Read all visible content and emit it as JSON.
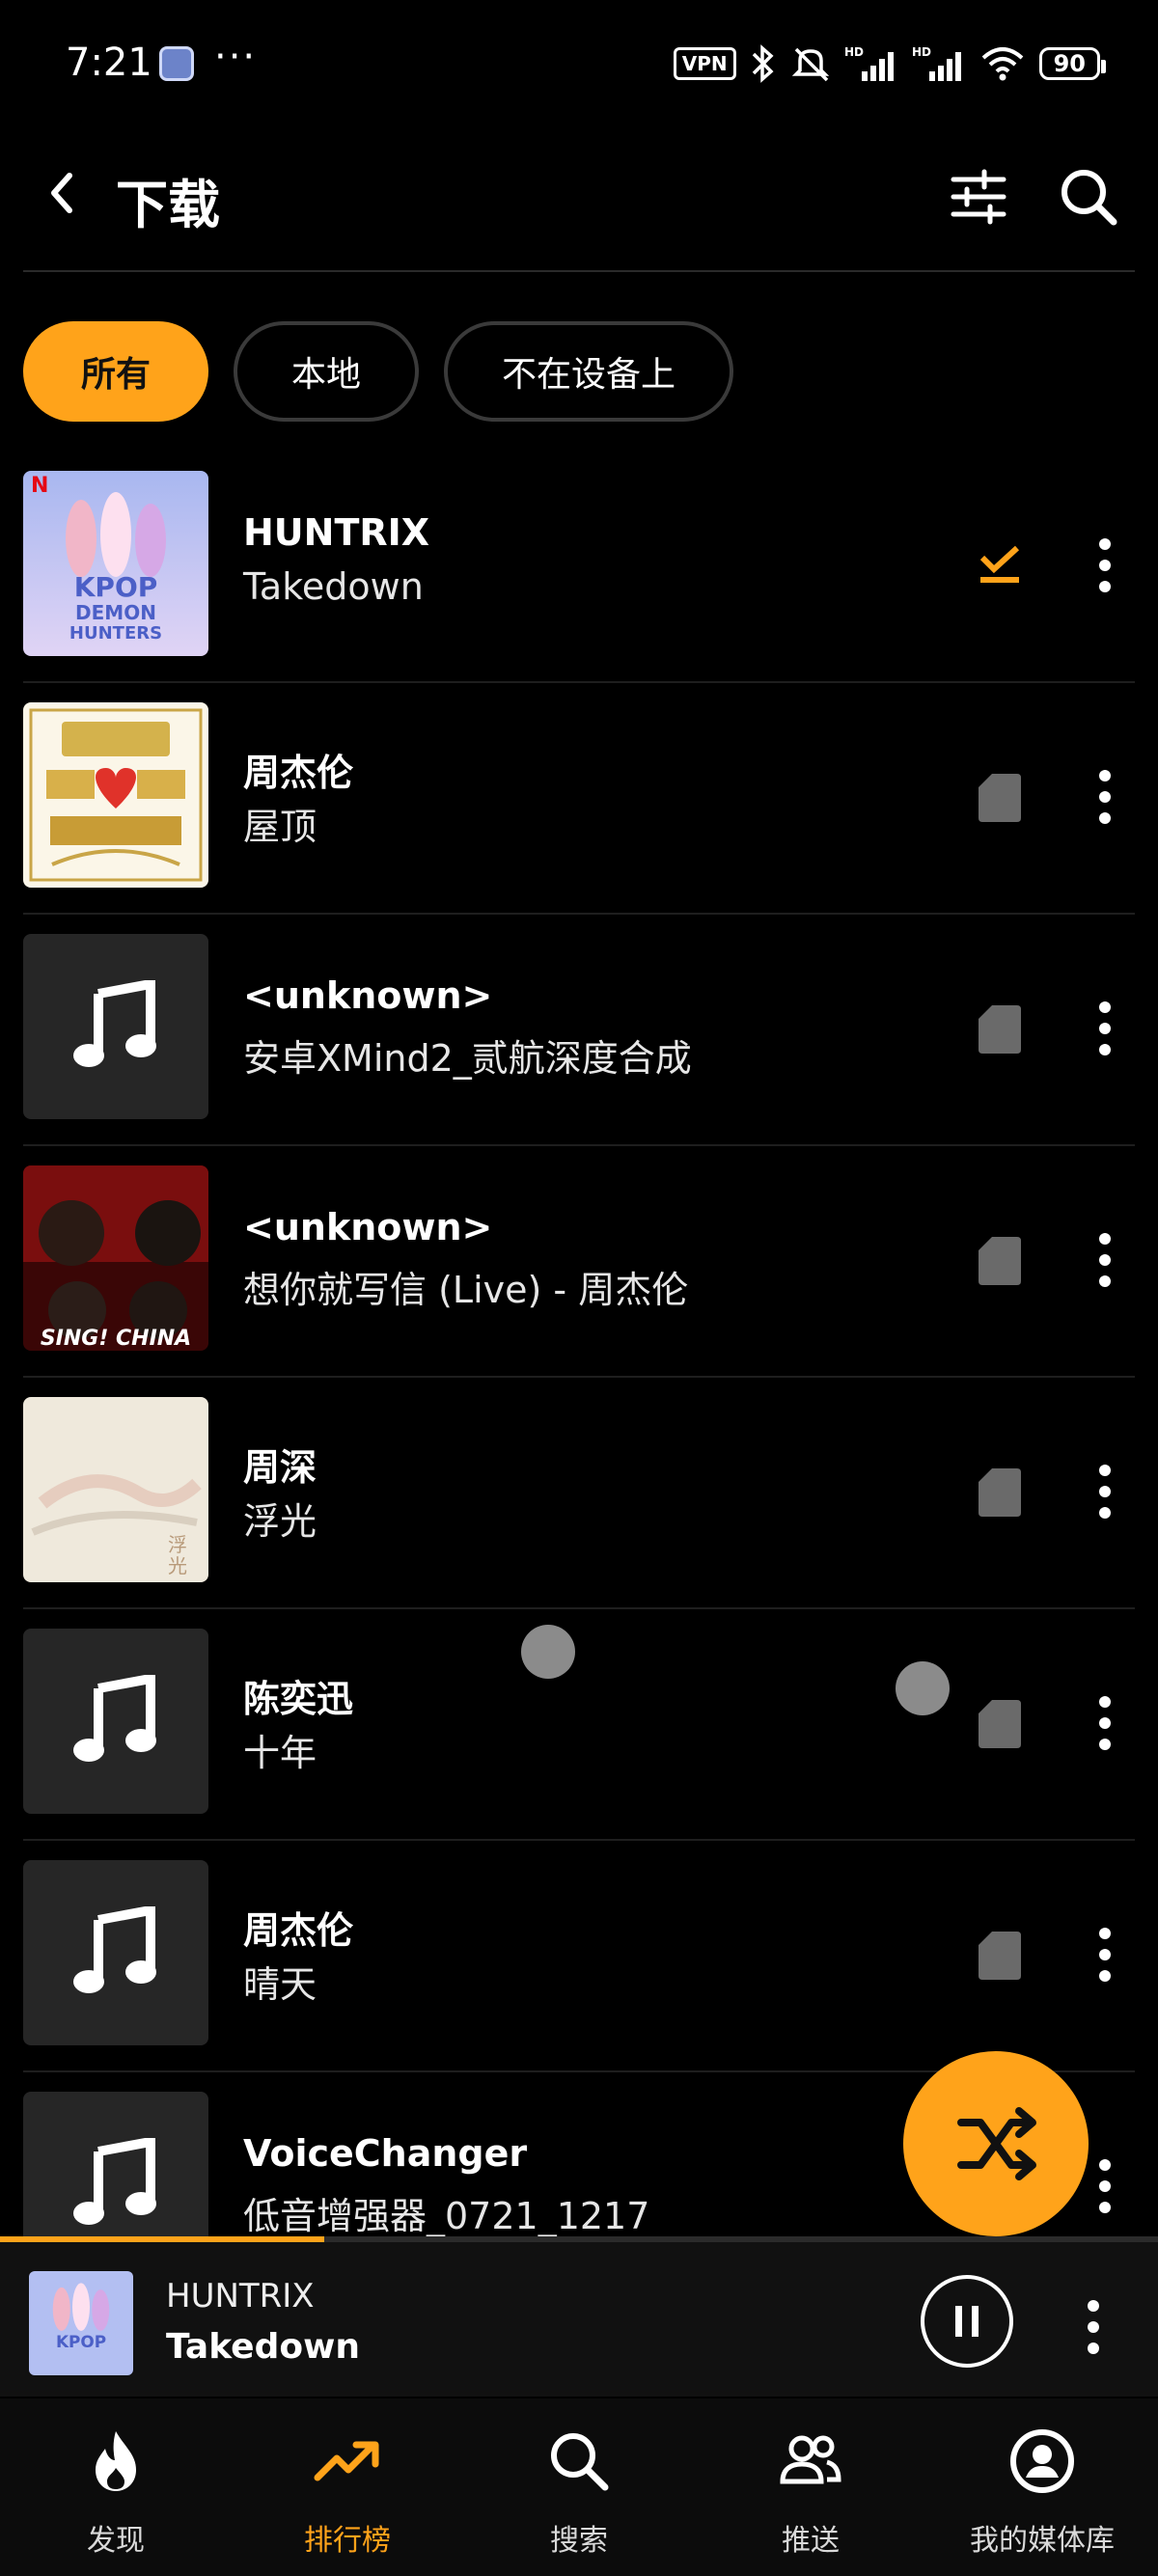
{
  "status_bar": {
    "time": "7:21",
    "dots": "···",
    "vpn": "VPN",
    "battery": "90",
    "icons": [
      "bluetooth-icon",
      "mute-icon",
      "signal-icon",
      "signal-icon",
      "wifi-icon",
      "battery-icon"
    ]
  },
  "header": {
    "title": "下载"
  },
  "chips": [
    {
      "label": "所有",
      "active": true
    },
    {
      "label": "本地",
      "active": false
    },
    {
      "label": "不在设备上",
      "active": false
    }
  ],
  "items": [
    {
      "title": "HUNTRIX",
      "subtitle": "Takedown",
      "art": "kpop-demon-hunters",
      "status": "downloaded-check-icon"
    },
    {
      "title": "周杰伦",
      "subtitle": "屋顶",
      "art": "duet-album",
      "status": "sd-card-icon"
    },
    {
      "title": "<unknown>",
      "subtitle": "安卓XMind2_贰航深度合成",
      "art": "music-note-icon",
      "status": "sd-card-icon"
    },
    {
      "title": "<unknown>",
      "subtitle": "想你就写信 (Live) - 周杰伦",
      "art": "sing-china",
      "status": "sd-card-icon"
    },
    {
      "title": "周深",
      "subtitle": "浮光",
      "art": "fuguang",
      "status": "sd-card-icon"
    },
    {
      "title": "陈奕迅",
      "subtitle": "十年",
      "art": "music-note-icon",
      "status": "sd-card-icon"
    },
    {
      "title": "周杰伦",
      "subtitle": "晴天",
      "art": "music-note-icon",
      "status": "sd-card-icon"
    },
    {
      "title": "VoiceChanger",
      "subtitle": "低音增强器_0721_1217",
      "art": "music-note-icon",
      "status": ""
    }
  ],
  "now_playing": {
    "artist": "HUNTRIX",
    "song": "Takedown",
    "progress": 0.28
  },
  "nav": [
    {
      "label": "发现",
      "icon": "fire-icon",
      "active": false
    },
    {
      "label": "排行榜",
      "icon": "trending-icon",
      "active": true
    },
    {
      "label": "搜索",
      "icon": "search-icon",
      "active": false
    },
    {
      "label": "推送",
      "icon": "people-icon",
      "active": false
    },
    {
      "label": "我的媒体库",
      "icon": "account-icon",
      "active": false
    }
  ],
  "accent": "#ffa31a"
}
